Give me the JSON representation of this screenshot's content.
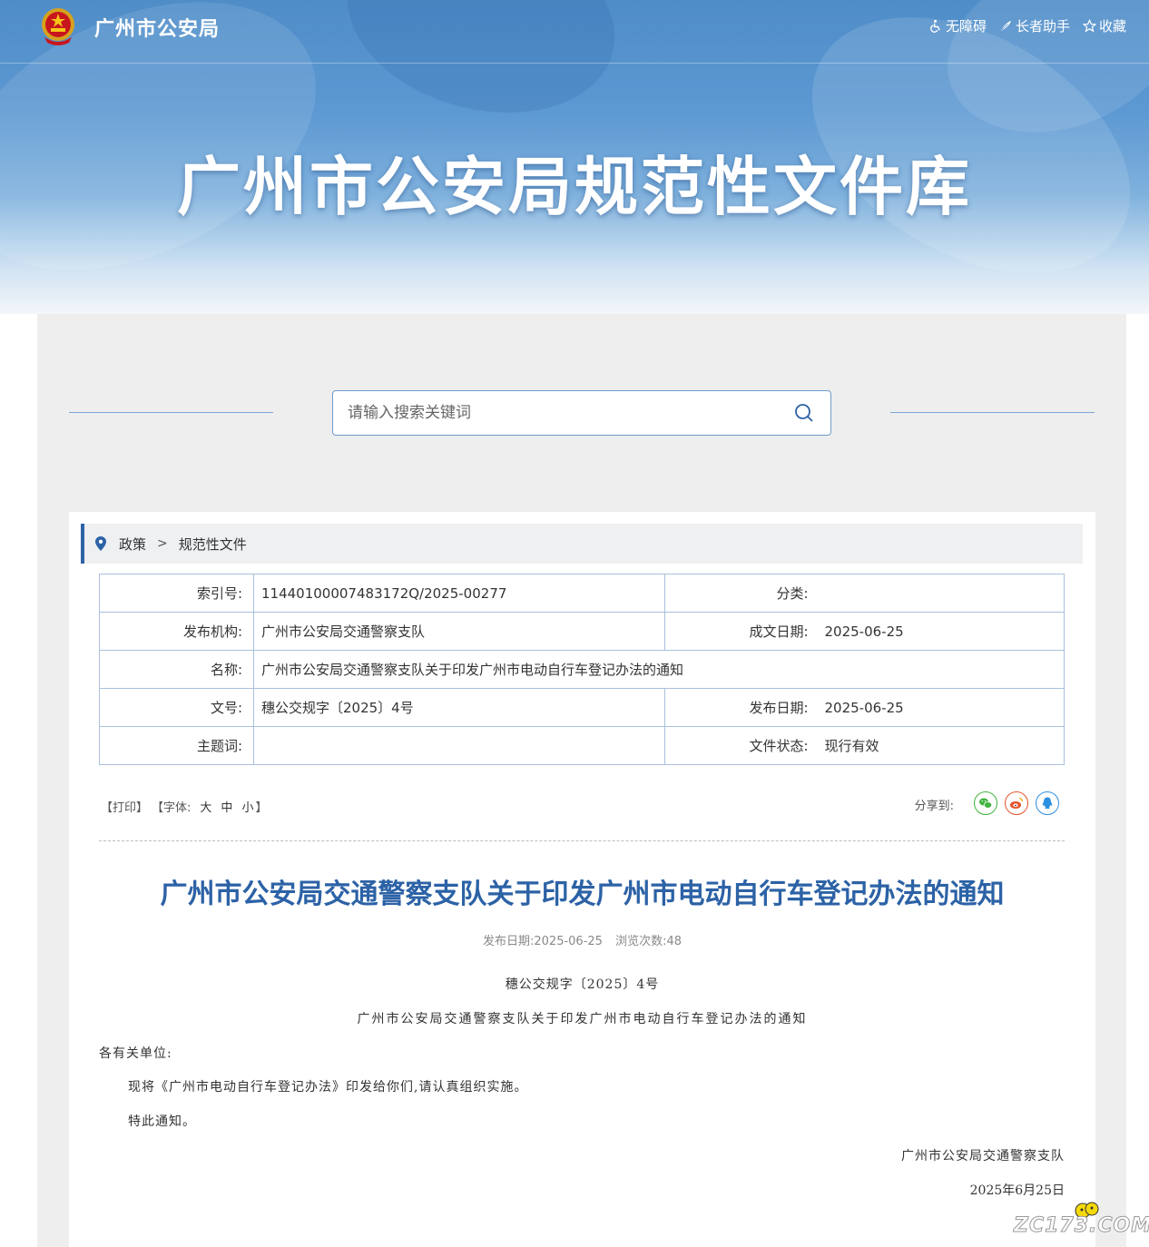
{
  "header": {
    "site_name": "广州市公安局",
    "links": [
      {
        "label": "无障碍",
        "icon": "accessibility-icon"
      },
      {
        "label": "长者助手",
        "icon": "elder-helper-icon"
      },
      {
        "label": "收藏",
        "icon": "star-icon"
      }
    ],
    "banner_title": "广州市公安局规范性文件库"
  },
  "search": {
    "placeholder": "请输入搜索关键词",
    "value": ""
  },
  "breadcrumb": {
    "items": [
      "政策",
      "规范性文件"
    ],
    "separator": ">"
  },
  "meta": {
    "index_no": {
      "label": "索引号:",
      "value": "11440100007483172Q/2025-00277"
    },
    "category": {
      "label": "分类:",
      "value": ""
    },
    "publisher": {
      "label": "发布机构:",
      "value": "广州市公安局交通警察支队"
    },
    "written_date": {
      "label": "成文日期:",
      "value": "2025-06-25"
    },
    "name": {
      "label": "名称:",
      "value": "广州市公安局交通警察支队关于印发广州市电动自行车登记办法的通知"
    },
    "doc_no": {
      "label": "文号:",
      "value": "穗公交规字〔2025〕4号"
    },
    "publish_date": {
      "label": "发布日期:",
      "value": "2025-06-25"
    },
    "keywords": {
      "label": "主题词:",
      "value": ""
    },
    "status": {
      "label": "文件状态:",
      "value": "现行有效"
    }
  },
  "toolbar": {
    "print": "【打印】",
    "font_label": "【字体:",
    "font_large": "大",
    "font_medium": "中",
    "font_small": "小",
    "font_close": "】",
    "share_label": "分享到:",
    "share": [
      {
        "name": "wechat",
        "color": "#3fb33f"
      },
      {
        "name": "weibo",
        "color": "#e6542a"
      },
      {
        "name": "qq",
        "color": "#2d8fe0"
      }
    ]
  },
  "article": {
    "title": "广州市公安局交通警察支队关于印发广州市电动自行车登记办法的通知",
    "publish_label": "发布日期:",
    "publish_date": "2025-06-25",
    "views_label": "浏览次数:",
    "views": "48",
    "doc_no": "穗公交规字〔2025〕4号",
    "subtitle": "广州市公安局交通警察支队关于印发广州市电动自行车登记办法的通知",
    "salutation": "各有关单位:",
    "paragraphs": [
      "现将《广州市电动自行车登记办法》印发给你们,请认真组织实施。",
      "特此通知。"
    ],
    "signature": "广州市公安局交通警察支队",
    "date": "2025年6月25日"
  },
  "watermark": "ZC173.COM",
  "colors": {
    "accent": "#2c62a6",
    "border": "#a9c1dc",
    "banner": "#5c98d2"
  }
}
